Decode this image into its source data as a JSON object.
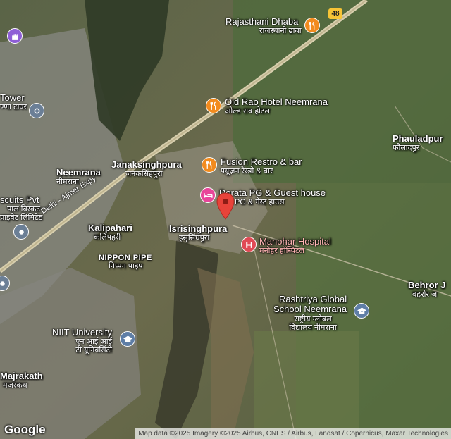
{
  "map": {
    "route_shield": "48",
    "road_label": "Delhi - Ajmer Expy",
    "logo": "Google",
    "attribution": "Map data ©2025 Imagery ©2025 Airbus, CNES / Airbus, Landsat / Copernicus, Maxar Technologies",
    "places": {
      "rajasthani_dhaba": {
        "en": "Rajasthani Dhaba",
        "hi": "राजस्थानी ढाबा"
      },
      "old_rao": {
        "en": "Old Rao Hotel Neemrana",
        "hi": "ओल्ड राव होटल"
      },
      "fusion": {
        "en": "Fusion Restro & bar",
        "hi": "फ्यूज़न रेस्त्रो & बार"
      },
      "dorata": {
        "en": "Dorata PG & Guest house",
        "hi": "PG & गेस्ट हाउस"
      },
      "manohar": {
        "en": "Manohar Hospital",
        "hi": "मनोहर हॉस्पिटल"
      },
      "rashtriya": {
        "en1": "Rashtriya Global",
        "en2": "School Neemrana",
        "hi1": "राष्ट्रीय ग्लोबल",
        "hi2": "विद्यालय नीमराना"
      },
      "phauladpur": {
        "en": "Phauladpur",
        "hi": "फौलादपुर"
      },
      "behror": {
        "en": "Behror J",
        "hi": "बहरोर ज"
      },
      "janaksinghpura": {
        "en": "Janaksinghpura",
        "hi": "जनकसिंहपुरा"
      },
      "neemrana": {
        "en": "Neemrana",
        "hi": "नीमराना"
      },
      "kalipahari": {
        "en": "Kalipahari",
        "hi": "कलिपहरी"
      },
      "isrisinghpura": {
        "en": "Isrisinghpura",
        "hi": "इसृसिंघपुरा"
      },
      "nippon": {
        "en": "NIPPON PIPE",
        "hi": "निप्पन पाइप"
      },
      "niit": {
        "en": "NIIT University",
        "hi1": "एन आई आई",
        "hi2": "टी यूनिवर्सिटी"
      },
      "majrakath": {
        "en": "Majrakath",
        "hi": "मजरकथ"
      },
      "tower": {
        "en": "Tower",
        "hi": "ण्णा टावर"
      },
      "biscuits": {
        "en": "scuits Pvt",
        "hi1": "पाल बिस्कट",
        "hi2": "प्राइवेट लिमिटेड"
      }
    }
  },
  "icons": {
    "restaurant": "restaurant-icon",
    "hotel": "hotel-icon",
    "hospital": "hospital-icon",
    "school": "school-icon",
    "pin": "location-pin-icon"
  },
  "colors": {
    "restaurant": "#f28b1e",
    "hotel": "#e8469a",
    "hospital": "#e04a55",
    "pin": "#e8433a",
    "school": "#5f7ea6"
  }
}
